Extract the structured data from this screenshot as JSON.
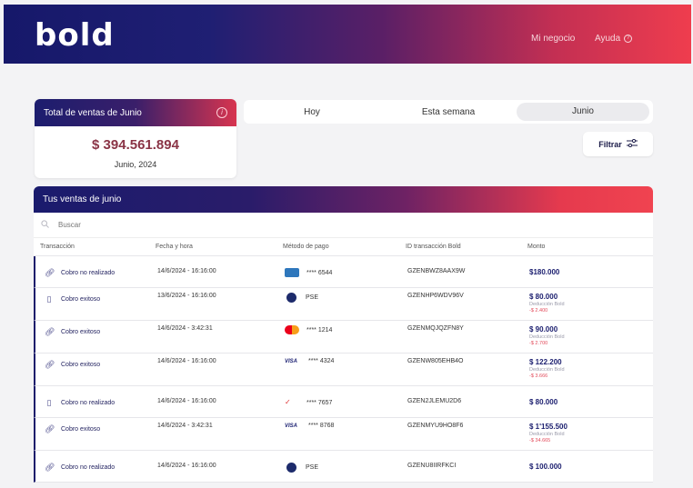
{
  "header": {
    "logo": "bold",
    "nav": {
      "mi_negocio": "Mi negocio",
      "ayuda": "Ayuda"
    }
  },
  "total_card": {
    "title": "Total de ventas de Junio",
    "amount": "$ 394.561.894",
    "date": "Junio, 2024"
  },
  "period_tabs": [
    {
      "label": "Hoy",
      "active": false
    },
    {
      "label": "Esta semana",
      "active": false
    },
    {
      "label": "Junio",
      "active": true
    }
  ],
  "filter_label": "Filtrar",
  "sales": {
    "title": "Tus ventas de junio",
    "search_placeholder": "Buscar",
    "columns": [
      "Transacción",
      "Fecha y hora",
      "Método de pago",
      "ID transacción Bold",
      "Monto"
    ],
    "rows": [
      {
        "icon": "link-icon",
        "transaction": "Cobro no realizado",
        "datetime": "14/6/2024 - 16:16:00",
        "payment": "amex",
        "payment_text": "**** 6544",
        "id": "GZENBWZ8AAX9W",
        "amount": "$180.000",
        "deduction_label": "",
        "deduction": ""
      },
      {
        "icon": "terminal-icon",
        "transaction": "Cobro exitoso",
        "datetime": "13/6/2024 - 16:16:00",
        "payment": "pse",
        "payment_text": "PSE",
        "id": "GZENHP6WDV96V",
        "amount": "$ 80.000",
        "deduction_label": "Deducción Bold",
        "deduction": "-$ 2.400"
      },
      {
        "icon": "link-icon",
        "transaction": "Cobro exitoso",
        "datetime": "14/6/2024 - 3:42:31",
        "payment": "mastercard",
        "payment_text": "**** 1214",
        "id": "GZENMQJQZFN8Y",
        "amount": "$ 90.000",
        "deduction_label": "Deducción Bold",
        "deduction": "-$ 2.700"
      },
      {
        "icon": "link-icon",
        "transaction": "Cobro exitoso",
        "datetime": "14/6/2024 - 16:16:00",
        "payment": "visa",
        "payment_text": "**** 4324",
        "id": "GZENW805EHB4O",
        "amount": "$ 122.200",
        "deduction_label": "Deducción Bold",
        "deduction": "-$ 3.666"
      },
      {
        "icon": "terminal-icon",
        "transaction": "Cobro no realizado",
        "datetime": "14/6/2024 - 16:16:00",
        "payment": "generic-card",
        "payment_text": "**** 7657",
        "id": "GZEN2JLEMU2D6",
        "amount": "$ 80.000",
        "deduction_label": "",
        "deduction": ""
      },
      {
        "icon": "link-icon",
        "transaction": "Cobro exitoso",
        "datetime": "14/6/2024 - 3:42:31",
        "payment": "visa",
        "payment_text": "**** 8768",
        "id": "GZENMYU9HO8F6",
        "amount": "$ 1'155.500",
        "deduction_label": "Deducción Bold",
        "deduction": "-$ 34.665"
      },
      {
        "icon": "link-icon",
        "transaction": "Cobro no realizado",
        "datetime": "14/6/2024 - 16:16:00",
        "payment": "pse",
        "payment_text": "PSE",
        "id": "GZENU8IIRFKCI",
        "amount": "$ 100.000",
        "deduction_label": "",
        "deduction": ""
      }
    ]
  }
}
